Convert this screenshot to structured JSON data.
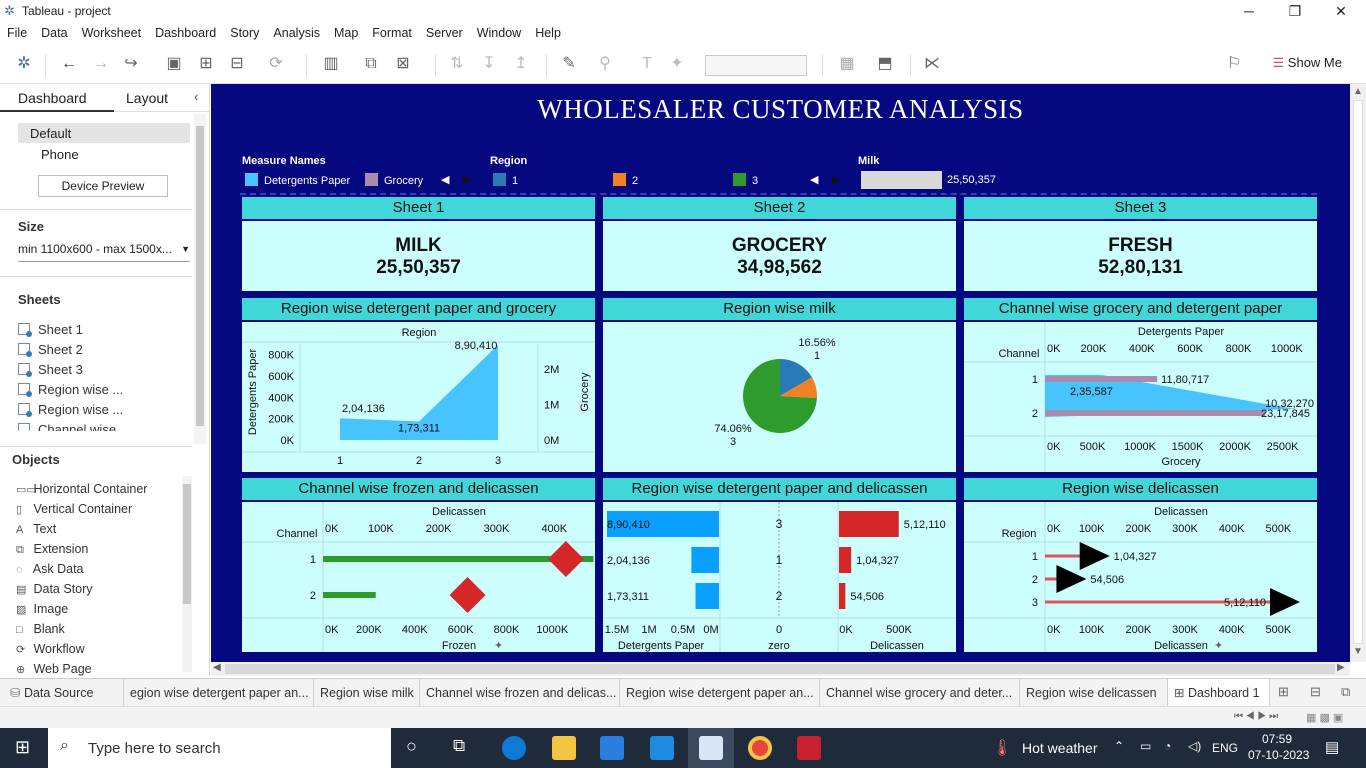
{
  "window": {
    "title": "Tableau - project",
    "minimize": "─",
    "maximize": "❐",
    "close": "✕"
  },
  "menu": [
    "File",
    "Data",
    "Worksheet",
    "Dashboard",
    "Story",
    "Analysis",
    "Map",
    "Format",
    "Server",
    "Window",
    "Help"
  ],
  "toolbar": {
    "show_me": "Show Me"
  },
  "left_panel": {
    "tabs": [
      "Dashboard",
      "Layout"
    ],
    "device": {
      "default": "Default",
      "phone": "Phone",
      "preview_button": "Device Preview"
    },
    "size": {
      "label": "Size",
      "value": "min 1100x600 - max 1500x..."
    },
    "sheets": {
      "label": "Sheets",
      "items": [
        "Sheet 1",
        "Sheet 2",
        "Sheet 3",
        "Region wise ...",
        "Region wise ...",
        "Channel wise ..."
      ]
    },
    "objects": {
      "label": "Objects",
      "items": [
        {
          "icon": "▭▭",
          "label": "Horizontal Container"
        },
        {
          "icon": "▯",
          "label": "Vertical Container"
        },
        {
          "icon": "A",
          "label": "Text"
        },
        {
          "icon": "⧉",
          "label": "Extension"
        },
        {
          "icon": "◌",
          "label": "Ask Data"
        },
        {
          "icon": "▤",
          "label": "Data Story"
        },
        {
          "icon": "▨",
          "label": "Image"
        },
        {
          "icon": "□",
          "label": "Blank"
        },
        {
          "icon": "⟳",
          "label": "Workflow"
        },
        {
          "icon": "⊕",
          "label": "Web Page"
        }
      ]
    }
  },
  "dashboard": {
    "title": "WHOLESALER CUSTOMER ANALYSIS",
    "legends": {
      "measure_names": {
        "label": "Measure Names",
        "items": [
          {
            "name": "Detergents Paper",
            "color": "#47c3ff"
          },
          {
            "name": "Grocery",
            "color": "#a98bb0"
          }
        ]
      },
      "region": {
        "label": "Region",
        "items": [
          {
            "name": "1",
            "color": "#2a7ab8"
          },
          {
            "name": "2",
            "color": "#f28024"
          },
          {
            "name": "3",
            "color": "#2e9c2c"
          }
        ]
      },
      "milk": {
        "label": "Milk",
        "value": "25,50,357"
      }
    },
    "kpis": [
      {
        "header": "Sheet 1",
        "label": "MILK",
        "value": "25,50,357"
      },
      {
        "header": "Sheet 2",
        "label": "GROCERY",
        "value": "34,98,562"
      },
      {
        "header": "Sheet 3",
        "label": "FRESH",
        "value": "52,80,131"
      }
    ],
    "chart_headers": [
      "Region wise detergent paper and grocery",
      "Region wise milk",
      "Channel wise grocery and detergent paper",
      "Channel wise frozen and delicassen",
      "Region wise detergent paper and delicassen",
      "Region wise delicassen"
    ]
  },
  "chart_data": [
    {
      "type": "area",
      "title": "Region wise detergent paper and grocery",
      "xlabel": "Region",
      "categories": [
        "1",
        "2",
        "3"
      ],
      "series": [
        {
          "name": "Detergents Paper",
          "values": [
            204136,
            173311,
            890410
          ],
          "axis": "left",
          "color": "#47c3ff"
        },
        {
          "name": "Grocery",
          "values": [
            520000,
            190000,
            2380000
          ],
          "axis": "right",
          "color": "#a98bb0"
        }
      ],
      "data_labels": [
        "2,04,136",
        "1,73,311",
        "8,90,410"
      ],
      "left_axis": {
        "label": "Detergents Paper",
        "ticks": [
          "0K",
          "200K",
          "400K",
          "600K",
          "800K"
        ],
        "range": [
          0,
          900000
        ]
      },
      "right_axis": {
        "label": "Grocery",
        "ticks": [
          "0M",
          "1M",
          "2M"
        ],
        "range": [
          0,
          2700000
        ]
      }
    },
    {
      "type": "pie",
      "title": "Region wise milk",
      "slices": [
        {
          "region": "1",
          "percent": 16.56,
          "color": "#2a7ab8",
          "label": "16.56%",
          "sublabel": "1"
        },
        {
          "region": "2",
          "percent": 9.38,
          "color": "#f28024"
        },
        {
          "region": "3",
          "percent": 74.06,
          "color": "#2e9c2c",
          "label": "74.06%",
          "sublabel": "3"
        }
      ]
    },
    {
      "type": "bar",
      "title": "Channel wise grocery and detergent paper",
      "categories": [
        "1",
        "2"
      ],
      "category_label": "Channel",
      "series": [
        {
          "name": "Grocery",
          "values": [
            1180717,
            2317845
          ],
          "color": "#a98bb0",
          "labels": [
            "11,80,717",
            "23,17,845"
          ]
        },
        {
          "name": "Detergents Paper",
          "values": [
            235587,
            1032270
          ],
          "color": "#47c3ff",
          "labels": [
            "2,35,587",
            "10,32,270"
          ]
        }
      ],
      "top_axis": {
        "label": "Detergents Paper",
        "ticks": [
          "0K",
          "200K",
          "400K",
          "600K",
          "800K",
          "1000K"
        ]
      },
      "bottom_axis": {
        "label": "Grocery",
        "ticks": [
          "0K",
          "500K",
          "1000K",
          "1500K",
          "2000K",
          "2500K"
        ]
      }
    },
    {
      "type": "bar",
      "title": "Channel wise frozen and delicassen",
      "categories": [
        "1",
        "2"
      ],
      "category_label": "Channel",
      "series": [
        {
          "name": "Frozen",
          "values": [
            1180000,
            230000
          ],
          "color": "#2e9c2c"
        },
        {
          "name": "Delicassen",
          "values": [
            420000,
            250000
          ],
          "color": "#d62728",
          "marker": "diamond"
        }
      ],
      "top_axis": {
        "label": "Delicassen",
        "ticks": [
          "0K",
          "100K",
          "200K",
          "300K",
          "400K"
        ]
      },
      "bottom_axis": {
        "label": "Frozen",
        "ticks": [
          "0K",
          "200K",
          "400K",
          "600K",
          "800K",
          "1000K"
        ]
      }
    },
    {
      "type": "bar",
      "title": "Region wise detergent paper and delicassen",
      "categories": [
        "3",
        "1",
        "2"
      ],
      "series": [
        {
          "name": "Detergents Paper",
          "values": [
            890410,
            204136,
            173311
          ],
          "color": "#09a0ff",
          "labels": [
            "8,90,410",
            "2,04,136",
            "1,73,311"
          ]
        },
        {
          "name": "Delicassen",
          "values": [
            512110,
            104327,
            54506
          ],
          "color": "#d62728",
          "labels": [
            "5,12,110",
            "1,04,327",
            "54,506"
          ]
        }
      ],
      "left_axis": {
        "label": "Detergents Paper",
        "ticks": [
          "1.5M",
          "1M",
          "0.5M",
          "0M"
        ]
      },
      "middle_axis": {
        "label": "zero",
        "ticks": [
          "0"
        ]
      },
      "right_axis": {
        "label": "Delicassen",
        "ticks": [
          "0K",
          "500K"
        ]
      }
    },
    {
      "type": "bar",
      "title": "Region wise delicassen",
      "categories": [
        "1",
        "2",
        "3"
      ],
      "category_label": "Region",
      "series": [
        {
          "name": "Delicassen",
          "values": [
            104327,
            54506,
            512110
          ],
          "color": "#e05656",
          "labels": [
            "1,04,327",
            "54,506",
            "5,12,110"
          ]
        }
      ],
      "top_axis": {
        "label": "Delicassen",
        "ticks": [
          "0K",
          "100K",
          "200K",
          "300K",
          "400K",
          "500K"
        ]
      },
      "bottom_axis": {
        "label": "Delicassen",
        "ticks": [
          "0K",
          "100K",
          "200K",
          "300K",
          "400K",
          "500K"
        ]
      }
    }
  ],
  "bottom_tabs": [
    {
      "label": "Data Source"
    },
    {
      "label": "egion wise detergent paper an..."
    },
    {
      "label": "Region wise milk"
    },
    {
      "label": "Channel wise frozen and delicas..."
    },
    {
      "label": "Region wise detergent paper an..."
    },
    {
      "label": "Channel wise grocery and deter..."
    },
    {
      "label": "Region wise delicassen"
    },
    {
      "label": "Dashboard 1",
      "active": true
    }
  ],
  "taskbar": {
    "search_placeholder": "Type here to search",
    "weather": "Hot weather",
    "lang": "ENG",
    "time": "07:59",
    "date": "07-10-2023"
  }
}
